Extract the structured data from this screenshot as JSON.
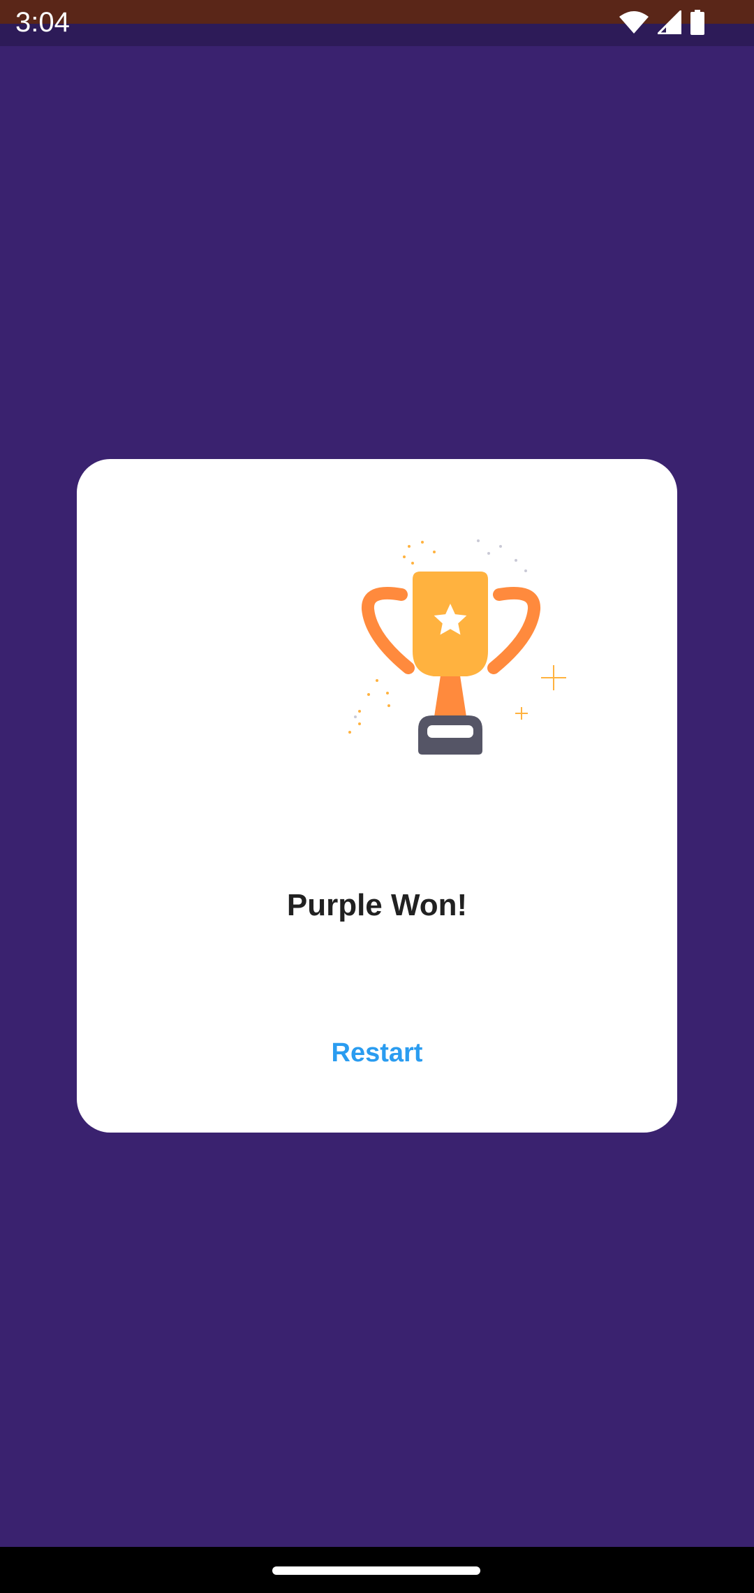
{
  "status_bar": {
    "time": "3:04",
    "icons": [
      "wifi-icon",
      "cellular-signal-icon",
      "battery-icon"
    ]
  },
  "dialog": {
    "image": "trophy-illustration",
    "title": "Purple Won!",
    "restart_label": "Restart"
  },
  "colors": {
    "background": "#3a226f",
    "status_bar_top": "#5a2618",
    "status_bar_bottom": "#2d1b58",
    "dialog": "#ffffff",
    "title_text": "#212121",
    "accent": "#2a9cf0",
    "trophy_cup": "#ffb23f",
    "trophy_handles": "#ff8a3d",
    "trophy_base": "#555566"
  }
}
